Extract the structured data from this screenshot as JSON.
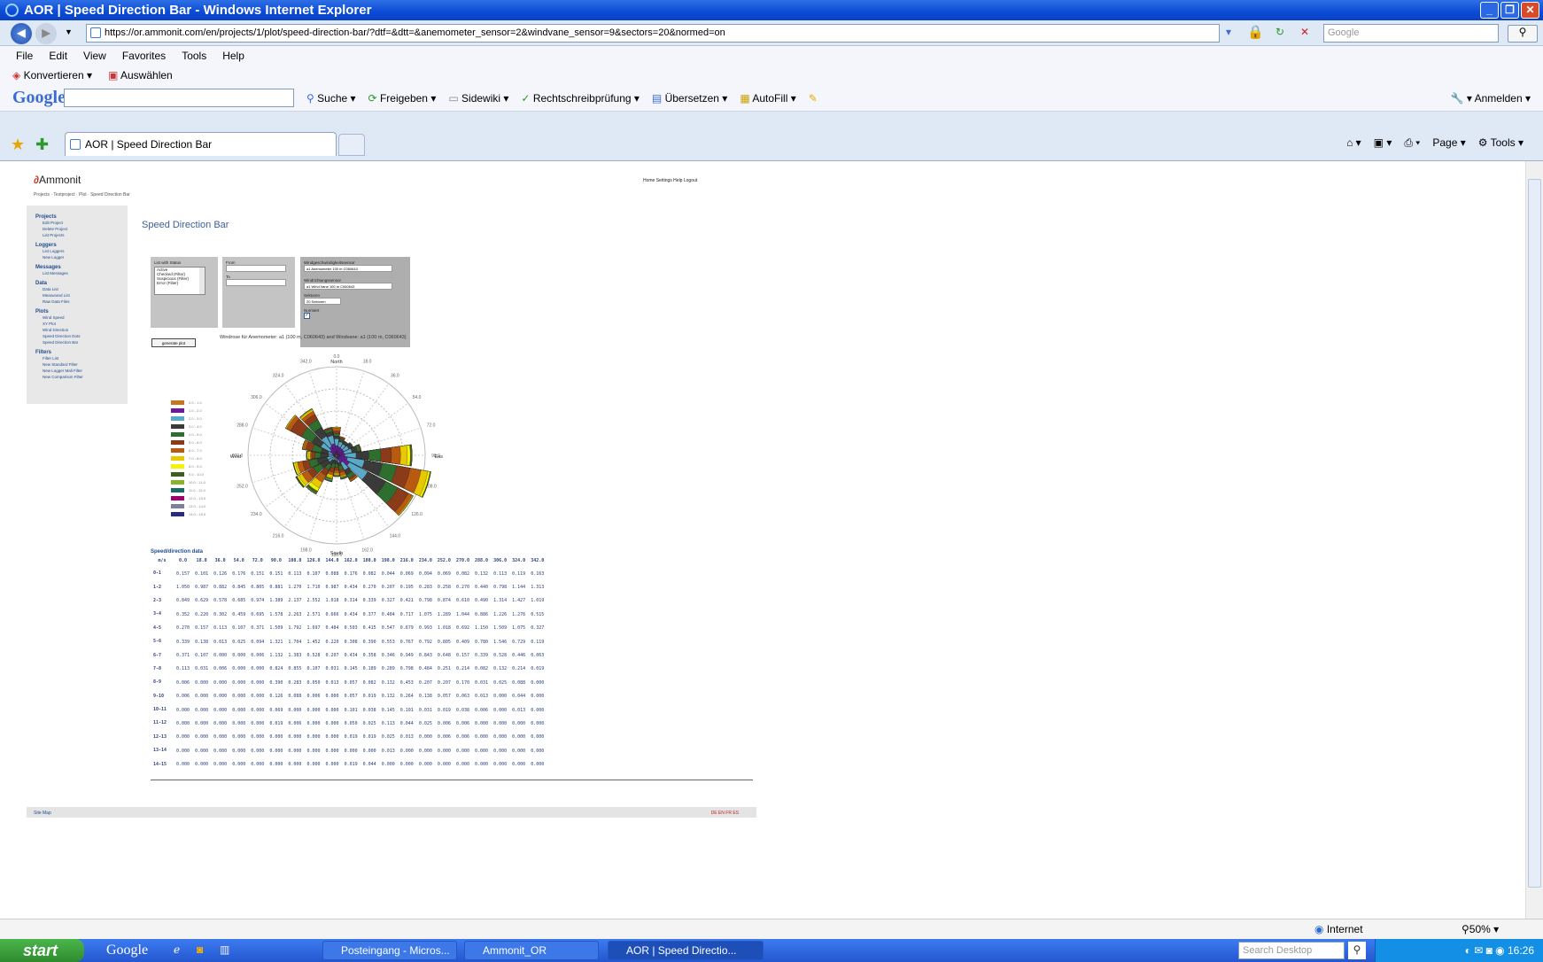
{
  "window": {
    "title": "AOR | Speed Direction Bar - Windows Internet Explorer"
  },
  "address_bar": {
    "url": "https://or.ammonit.com/en/projects/1/plot/speed-direction-bar/?dtf=&dtt=&anemometer_sensor=2&windvane_sensor=9&sectors=20&normed=on",
    "search_placeholder": "Google"
  },
  "menu": [
    "File",
    "Edit",
    "View",
    "Favorites",
    "Tools",
    "Help"
  ],
  "menu2": [
    "Konvertieren",
    "Auswählen"
  ],
  "google_bar": {
    "logo": "Google",
    "items": [
      "Suche",
      "Freigeben",
      "Sidewiki",
      "Rechtschreibprüfung",
      "Übersetzen",
      "AutoFill"
    ],
    "signin": "Anmelden"
  },
  "tabs": {
    "active": "AOR | Speed Direction Bar"
  },
  "command_bar": [
    "Page",
    "Tools"
  ],
  "page": {
    "logo": "Ammonit",
    "breadcrumb": "Projects · Testproject · Plot · Speed Direction Bar",
    "top_nav": "Home Settings Help Logout",
    "title": "Speed Direction Bar",
    "sidebar": [
      {
        "section": "Projects",
        "links": [
          "Edit Project",
          "Delete Project",
          "List Projects"
        ]
      },
      {
        "section": "Loggers",
        "links": [
          "List Loggers",
          "New Logger"
        ]
      },
      {
        "section": "Messages",
        "links": [
          "List Messages"
        ]
      },
      {
        "section": "Data",
        "links": [
          "Data List",
          "Measurand List",
          "Raw Data Files"
        ]
      },
      {
        "section": "Plots",
        "links": [
          "Wind Speed",
          "XY Plot",
          "Wind Direction",
          "Speed Direction Dots",
          "Speed Direction Bar"
        ]
      },
      {
        "section": "Filters",
        "links": [
          "Filter List",
          "New Standard Filter",
          "New Logger Mali Filter",
          "New Comparison Filter"
        ]
      }
    ],
    "form": {
      "status_label": "List with Status",
      "status_options": [
        "Active",
        "Checked (Filter)",
        "Suspicious (Filter)",
        "Error (Filter)"
      ],
      "from_label": "From",
      "to_label": "To",
      "anemometer_label": "Windgeschwindigkeitssensor",
      "anemometer_value": "a1 Anemometer 100 m C060643",
      "windvane_label": "Windrichtungssensor",
      "windvane_value": "a1 Wind Vane 100 m C060643",
      "sectors_label": "Sektoren",
      "sectors_value": "20 Sektoren",
      "normed_label": "Normiert"
    },
    "generate_button": "generate plot",
    "chart_title": "Windrose für Anemometer: a1 (100 m, C060643) and Windvane: a1 (100 m, C060643)",
    "footer_left": "Site Map",
    "footer_right": "DE EN FR ES"
  },
  "chart_data": {
    "type": "bar",
    "title": "Windrose für Anemometer: a1 (100 m, C060643) and Windvane: a1 (100 m, C060643)",
    "direction_labels": [
      "0.0",
      "18.0",
      "36.0",
      "54.0",
      "72.0",
      "90.0",
      "108.0",
      "126.0",
      "144.0",
      "162.0",
      "180.0",
      "198.0",
      "216.0",
      "234.0",
      "252.0",
      "270.0",
      "288.0",
      "306.0",
      "324.0",
      "342.0"
    ],
    "speed_bins": [
      "0-1",
      "1-2",
      "2-3",
      "3-4",
      "4-5",
      "5-6",
      "6-7",
      "7-8",
      "8-9",
      "9-10",
      "10-11",
      "11-12",
      "12-13",
      "13-14",
      "14-15"
    ],
    "colors": [
      "#c8761e",
      "#6a1b9a",
      "#5aa9c8",
      "#3a3a3a",
      "#2e6e2e",
      "#8b3a1a",
      "#b85a10",
      "#e8c800",
      "#f4f400",
      "#3b5f1e",
      "#8ab32a",
      "#1a6a6a",
      "#a0006a",
      "#7f7f9a",
      "#2a2a80"
    ],
    "legend_values": [
      "0.0 - 1.0",
      "1.0 - 2.0",
      "2.0 - 3.0",
      "3.0 - 4.0",
      "4.0 - 5.0",
      "5.0 - 6.0",
      "6.0 - 7.0",
      "7.0 - 8.0",
      "8.0 - 9.0",
      "9.0 - 10.0",
      "10.0 - 11.0",
      "11.0 - 12.0",
      "12.0 - 13.0",
      "13.0 - 14.0",
      "14.0 - 15.0"
    ],
    "compass": {
      "north": "North",
      "south": "South",
      "east": "East",
      "west": "West"
    },
    "table_header": [
      "m/s",
      "0.0",
      "18.0",
      "36.0",
      "54.0",
      "72.0",
      "90.0",
      "108.0",
      "126.0",
      "144.0",
      "162.0",
      "180.0",
      "198.0",
      "216.0",
      "234.0",
      "252.0",
      "270.0",
      "288.0",
      "306.0",
      "324.0",
      "342.0"
    ],
    "rows": [
      [
        "0-1",
        "0.157",
        "0.101",
        "0.126",
        "0.176",
        "0.151",
        "0.151",
        "0.113",
        "0.107",
        "0.088",
        "0.176",
        "0.082",
        "0.044",
        "0.069",
        "0.094",
        "0.069",
        "0.082",
        "0.132",
        "0.113",
        "0.119",
        "0.163"
      ],
      [
        "1-2",
        "1.050",
        "0.987",
        "0.882",
        "0.845",
        "0.805",
        "0.881",
        "1.270",
        "1.710",
        "0.987",
        "0.434",
        "0.270",
        "0.207",
        "0.195",
        "0.283",
        "0.258",
        "0.270",
        "0.440",
        "0.798",
        "1.144",
        "1.313"
      ],
      [
        "2-3",
        "0.849",
        "0.629",
        "0.578",
        "0.685",
        "0.974",
        "1.389",
        "2.137",
        "2.552",
        "1.018",
        "0.314",
        "0.339",
        "0.327",
        "0.421",
        "0.798",
        "0.874",
        "0.610",
        "0.490",
        "1.314",
        "1.427",
        "1.019"
      ],
      [
        "3-4",
        "0.352",
        "0.220",
        "0.302",
        "0.459",
        "0.695",
        "1.578",
        "2.263",
        "2.571",
        "0.666",
        "0.434",
        "0.377",
        "0.484",
        "0.717",
        "1.075",
        "1.289",
        "1.044",
        "0.886",
        "1.226",
        "1.276",
        "0.515"
      ],
      [
        "4-5",
        "0.270",
        "0.157",
        "0.113",
        "0.107",
        "0.371",
        "1.509",
        "1.792",
        "1.697",
        "0.484",
        "0.503",
        "0.415",
        "0.547",
        "0.679",
        "0.993",
        "1.018",
        "0.692",
        "1.150",
        "1.509",
        "1.075",
        "0.327"
      ],
      [
        "5-6",
        "0.339",
        "0.138",
        "0.013",
        "0.025",
        "0.094",
        "1.321",
        "1.704",
        "1.452",
        "0.220",
        "0.308",
        "0.390",
        "0.553",
        "0.767",
        "0.792",
        "0.805",
        "0.409",
        "0.780",
        "1.546",
        "0.729",
        "0.119"
      ],
      [
        "6-7",
        "0.371",
        "0.107",
        "0.000",
        "0.000",
        "0.006",
        "1.132",
        "1.383",
        "0.528",
        "0.207",
        "0.434",
        "0.358",
        "0.346",
        "0.949",
        "0.843",
        "0.648",
        "0.157",
        "0.339",
        "0.528",
        "0.446",
        "0.063"
      ],
      [
        "7-8",
        "0.113",
        "0.031",
        "0.006",
        "0.000",
        "0.000",
        "0.824",
        "0.855",
        "0.107",
        "0.031",
        "0.145",
        "0.189",
        "0.289",
        "0.798",
        "0.484",
        "0.251",
        "0.214",
        "0.082",
        "0.132",
        "0.214",
        "0.019"
      ],
      [
        "8-9",
        "0.006",
        "0.000",
        "0.000",
        "0.000",
        "0.000",
        "0.390",
        "0.283",
        "0.050",
        "0.013",
        "0.057",
        "0.082",
        "0.132",
        "0.453",
        "0.207",
        "0.207",
        "0.170",
        "0.031",
        "0.025",
        "0.088",
        "0.000"
      ],
      [
        "9-10",
        "0.006",
        "0.000",
        "0.000",
        "0.000",
        "0.000",
        "0.126",
        "0.088",
        "0.006",
        "0.000",
        "0.057",
        "0.019",
        "0.132",
        "0.264",
        "0.138",
        "0.057",
        "0.063",
        "0.013",
        "0.000",
        "0.044",
        "0.000"
      ],
      [
        "10-11",
        "0.000",
        "0.000",
        "0.000",
        "0.000",
        "0.000",
        "0.069",
        "0.000",
        "0.000",
        "0.000",
        "0.101",
        "0.038",
        "0.145",
        "0.101",
        "0.031",
        "0.019",
        "0.038",
        "0.006",
        "0.000",
        "0.013",
        "0.000"
      ],
      [
        "11-12",
        "0.000",
        "0.000",
        "0.000",
        "0.000",
        "0.000",
        "0.019",
        "0.006",
        "0.000",
        "0.000",
        "0.050",
        "0.025",
        "0.113",
        "0.044",
        "0.025",
        "0.006",
        "0.006",
        "0.000",
        "0.000",
        "0.000",
        "0.000"
      ],
      [
        "12-13",
        "0.000",
        "0.000",
        "0.000",
        "0.000",
        "0.000",
        "0.000",
        "0.000",
        "0.000",
        "0.000",
        "0.019",
        "0.019",
        "0.025",
        "0.013",
        "0.000",
        "0.006",
        "0.006",
        "0.000",
        "0.000",
        "0.000",
        "0.000"
      ],
      [
        "13-14",
        "0.000",
        "0.000",
        "0.000",
        "0.000",
        "0.000",
        "0.000",
        "0.000",
        "0.000",
        "0.000",
        "0.000",
        "0.000",
        "0.013",
        "0.000",
        "0.000",
        "0.000",
        "0.000",
        "0.000",
        "0.000",
        "0.000",
        "0.000"
      ],
      [
        "14-15",
        "0.000",
        "0.000",
        "0.000",
        "0.000",
        "0.000",
        "0.000",
        "0.000",
        "0.000",
        "0.000",
        "0.019",
        "0.044",
        "0.000",
        "0.000",
        "0.000",
        "0.000",
        "0.000",
        "0.000",
        "0.000",
        "0.000",
        "0.000"
      ]
    ],
    "table_title": "Speed/direction data"
  },
  "status_bar": {
    "zone": "Internet",
    "zoom": "50%"
  },
  "taskbar": {
    "start": "start",
    "google": "Google",
    "tasks": [
      "Posteingang - Micros...",
      "Ammonit_OR",
      "AOR | Speed Directio..."
    ],
    "search_placeholder": "Search Desktop",
    "clock": "16:26"
  }
}
